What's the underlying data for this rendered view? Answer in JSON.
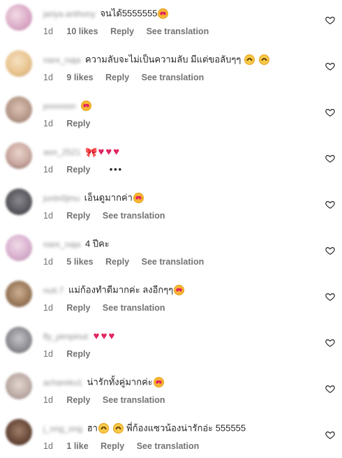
{
  "comments": [
    {
      "username": "jariya.anthony",
      "text": "จนได้5555555",
      "emoji": "heart-eyes",
      "time": "1d",
      "likes": "10 likes",
      "reply": "Reply",
      "translate": "See translation",
      "avatar_color": "#d9a6c4"
    },
    {
      "username": "nare_naja",
      "text": "ความลับจะไม่เป็นความลับ มีแต่ขอลับๆๆ",
      "emoji": "laugh-laugh",
      "time": "1d",
      "likes": "9 likes",
      "reply": "Reply",
      "translate": "See translation",
      "avatar_color": "#e8c48e"
    },
    {
      "username": "pooooon",
      "text": "",
      "emoji": "heart-eyes",
      "time": "1d",
      "likes": "",
      "reply": "Reply",
      "translate": "",
      "avatar_color": "#b89a8a"
    },
    {
      "username": "aon_2521",
      "text": "",
      "emoji": "bow-hearts",
      "time": "1d",
      "likes": "",
      "reply": "Reply",
      "translate": "",
      "avatar_color": "#c9a8a0",
      "more": "•••"
    },
    {
      "username": "juntn0jmu",
      "text": "เอ็นดูมากค่า",
      "emoji": "heart-eyes",
      "time": "1d",
      "likes": "",
      "reply": "Reply",
      "translate": "See translation",
      "avatar_color": "#5a5a60"
    },
    {
      "username": "nare_naja",
      "text": "4 ปีคะ",
      "emoji": "",
      "time": "1d",
      "likes": "5 likes",
      "reply": "Reply",
      "translate": "See translation",
      "avatar_color": "#d9b0cf"
    },
    {
      "username": "nuti.7",
      "text": "แม่ก้องทำดีมากค่ะ ลงอีกๆๆ",
      "emoji": "heart-eyes",
      "time": "1d",
      "likes": "",
      "reply": "Reply",
      "translate": "See translation",
      "avatar_color": "#9c7b5c"
    },
    {
      "username": "fly_pimpinut",
      "text": "",
      "emoji": "three-hearts",
      "time": "1d",
      "likes": "",
      "reply": "Reply",
      "translate": "",
      "avatar_color": "#8f8f95"
    },
    {
      "username": "achareku1",
      "text": "น่ารักทั้งคู่มากค่ะ",
      "emoji": "heart-eyes",
      "time": "1d",
      "likes": "",
      "reply": "Reply",
      "translate": "See translation",
      "avatar_color": "#bfaea8"
    },
    {
      "username": "j_ong_ong",
      "text": "ฮา",
      "text2": "พี่ก้องแซวน้องน่ารักอ่ะ 555555",
      "emoji": "rofl-rofl",
      "time": "1d",
      "likes": "1 like",
      "reply": "Reply",
      "translate": "See translation",
      "avatar_color": "#6b4a3a"
    }
  ]
}
